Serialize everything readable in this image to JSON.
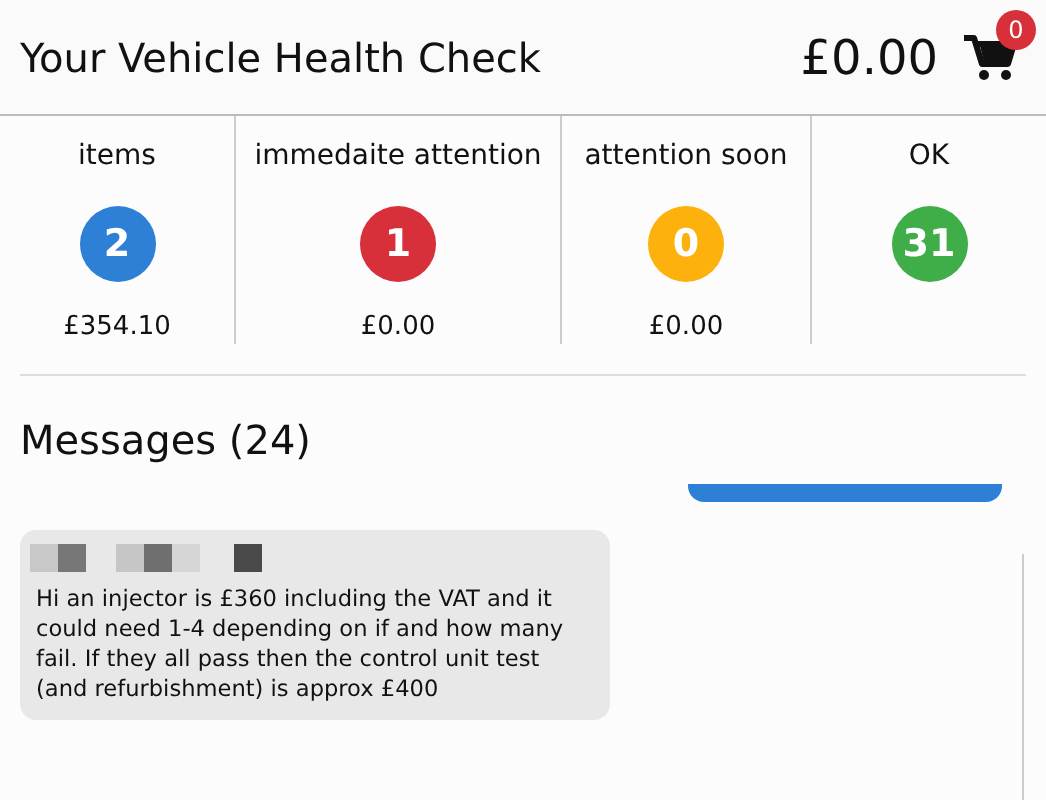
{
  "header": {
    "title": "Your Vehicle Health Check",
    "total": "£0.00",
    "cart_count": "0"
  },
  "summary": [
    {
      "label": "items",
      "count": "2",
      "amount": "£354.10",
      "color": "#2e7fd6"
    },
    {
      "label": "immedaite attention",
      "count": "1",
      "amount": "£0.00",
      "color": "#d8303a"
    },
    {
      "label": "attention soon",
      "count": "0",
      "amount": "£0.00",
      "color": "#fdb10d"
    },
    {
      "label": "OK",
      "count": "31",
      "color": "#3fae49"
    }
  ],
  "messages": {
    "heading": "Messages (24)",
    "items": [
      {
        "kind": "outgoing"
      },
      {
        "kind": "incoming",
        "text": "Hi an injector is £360 including the VAT and it could need 1-4 depending on if and how many fail. If they all pass then the control unit test (and refurbishment) is approx £400"
      }
    ]
  }
}
